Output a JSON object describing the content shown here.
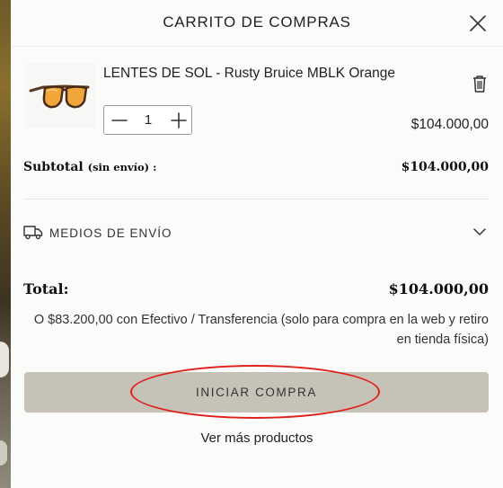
{
  "cart": {
    "title": "CARRITO DE COMPRAS",
    "item": {
      "name": "LENTES DE SOL - Rusty Bruice MBLK Orange",
      "quantity": "1",
      "price": "$104.000,00",
      "lens_color": "#f0a63a"
    },
    "subtotal": {
      "label": "Subtotal",
      "note": "(sin envío) :",
      "value": "$104.000,00"
    },
    "shipping": {
      "label": "MEDIOS DE ENVÍO"
    },
    "total": {
      "label": "Total:",
      "value": "$104.000,00",
      "alternative": "O $83.200,00 con Efectivo / Transferencia (solo para compra en la web y retiro en tienda física)"
    },
    "checkout_label": "INICIAR COMPRA",
    "more_products_label": "Ver más productos"
  },
  "colors": {
    "checkout_button": "#c7c2b7",
    "highlight": "#e0201b"
  }
}
